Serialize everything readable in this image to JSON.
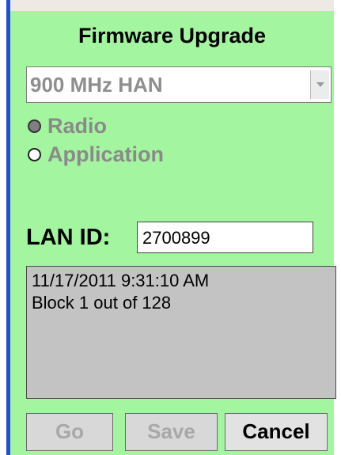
{
  "app": {
    "title": "Firmware Upgrade"
  },
  "network_select": {
    "value": "900 MHz HAN"
  },
  "target": {
    "options": [
      {
        "label": "Radio",
        "selected": true
      },
      {
        "label": "Application",
        "selected": false
      }
    ]
  },
  "lan": {
    "label": "LAN ID:",
    "value": "2700899"
  },
  "status": {
    "timestamp": "11/17/2011 9:31:10 AM",
    "progress": "Block 1 out of 128"
  },
  "buttons": {
    "go": "Go",
    "save": "Save",
    "cancel": "Cancel"
  },
  "colors": {
    "panel": "#a3f59f",
    "accent_bar": "#1f4fd6"
  },
  "icons": {
    "dropdown": "chevron-down-icon"
  }
}
